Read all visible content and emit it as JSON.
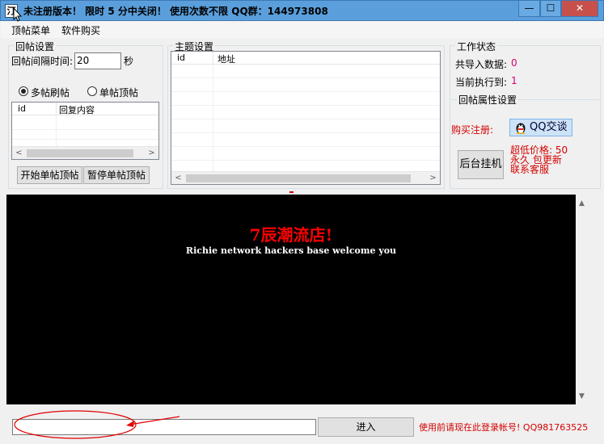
{
  "window": {
    "title": "未注册版本！ 限时 5 分中关闭！  使用次数不限 QQ群：144973808",
    "icon_text": "汀",
    "minimize": "—",
    "maximize": "☐",
    "close": "✕"
  },
  "menu": [
    "顶帖菜单",
    "软件购买"
  ],
  "reply_settings": {
    "group_label": "回帖设置",
    "interval_label": "回帖间隔时间:",
    "interval_value": "20",
    "interval_unit": "秒",
    "radio_multi": "多帖刷帖",
    "radio_single": "单帖顶帖",
    "radio_selected": "multi",
    "list_columns": [
      "id",
      "回复内容"
    ],
    "start_button": "开始单帖顶帖",
    "pause_button": "暂停单帖顶帖"
  },
  "topic_settings": {
    "group_label": "主题设置",
    "list_columns": [
      "id",
      "地址"
    ]
  },
  "work_status": {
    "group_label": "工作状态",
    "imported_label": "共导入数据:",
    "imported_value": "0",
    "current_label": "当前执行到:",
    "current_value": "1"
  },
  "reply_props": {
    "group_label": "回帖属性设置",
    "purchase_label": "购买注册:",
    "qq_button": "QQ交谈",
    "background_button": "后台挂机",
    "price_line": "超低价格: 50",
    "update_line": "永久 包更新",
    "contact_line": "联系客服"
  },
  "console": {
    "title": "7辰潮流店!",
    "subtitle": "Richie network hackers base welcome you"
  },
  "login": {
    "account_value": "",
    "enter_button": "进入",
    "notice": "使用前请现在此登录帐号! QQ981763525"
  },
  "colors": {
    "titlebar": "#5a9fdb",
    "close_button": "#c7504b",
    "notice_red": "#d40000",
    "status_value": "#d4006a",
    "console_bg": "#000000",
    "annotation_red": "#e00000"
  }
}
